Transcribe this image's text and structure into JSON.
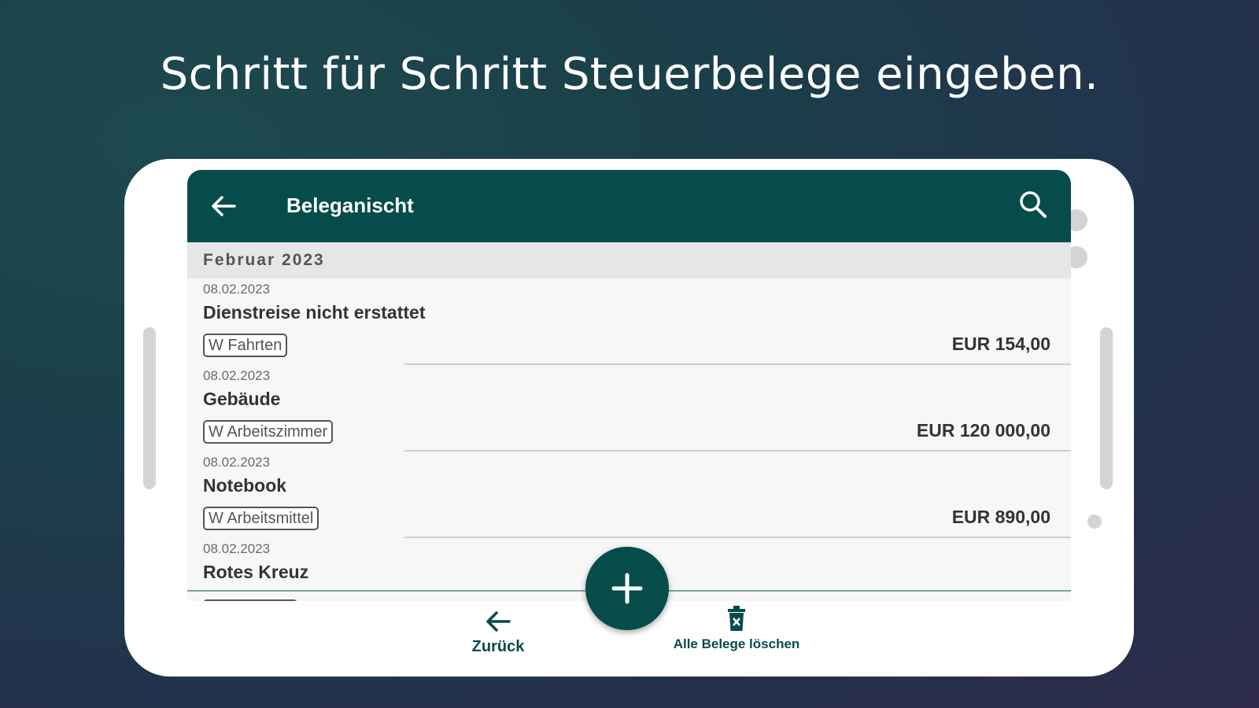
{
  "headline": "Schritt für Schritt Steuerbelege eingeben.",
  "appbar": {
    "title": "Beleganischt",
    "back_icon": "arrow-left-icon",
    "search_icon": "search-icon"
  },
  "month": "Februar 2023",
  "entries": [
    {
      "date": "08.02.2023",
      "name": "Dienstreise nicht erstattet",
      "tag": "W Fahrten",
      "amount": "EUR 154,00"
    },
    {
      "date": "08.02.2023",
      "name": "Gebäude",
      "tag": "W Arbeitszimmer",
      "amount": "EUR 120 000,00"
    },
    {
      "date": "08.02.2023",
      "name": "Notebook",
      "tag": "W Arbeitsmittel",
      "amount": "EUR 890,00"
    },
    {
      "date": "08.02.2023",
      "name": "Rotes Kreuz",
      "tag": "",
      "amount": ""
    }
  ],
  "bottom_nav": {
    "back_label": "Zurück",
    "delete_label": "Alle Belege löschen",
    "add_icon": "plus-icon",
    "back_icon": "arrow-left-icon",
    "delete_icon": "trash-icon"
  },
  "colors": {
    "primary": "#064c4a",
    "background": "#1b3f4a"
  }
}
